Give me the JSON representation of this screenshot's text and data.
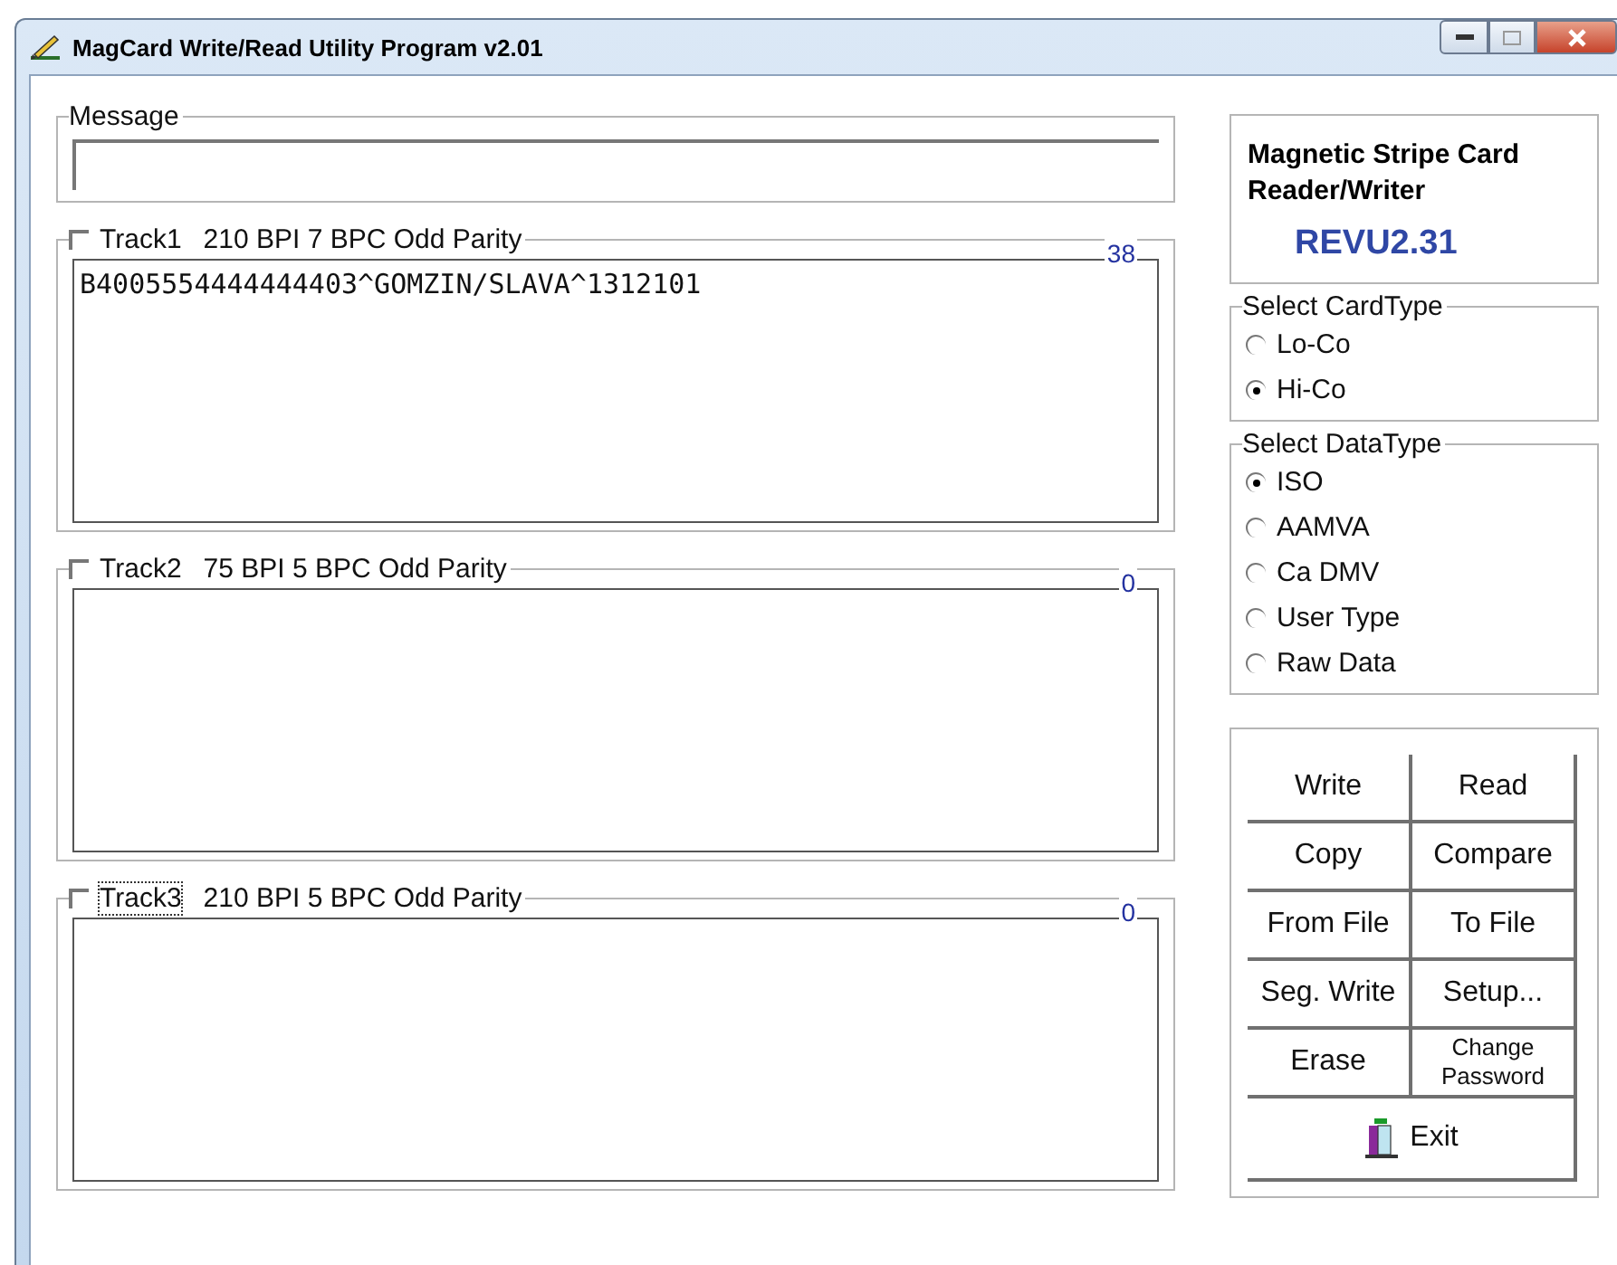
{
  "window": {
    "title": "MagCard Write/Read Utility Program v2.01"
  },
  "message": {
    "label": "Message"
  },
  "tracks": [
    {
      "label": "Track1",
      "spec": "210 BPI  7 BPC  Odd Parity",
      "count": "38",
      "checked": false,
      "focused": false,
      "value": "B4005554444444403^GOMZIN/SLAVA^1312101"
    },
    {
      "label": "Track2",
      "spec": "75 BPI  5 BPC  Odd Parity",
      "count": "0",
      "checked": false,
      "focused": false
    },
    {
      "label": "Track3",
      "spec": "210 BPI  5 BPC  Odd Parity",
      "count": "0",
      "checked": false,
      "focused": true
    }
  ],
  "device": {
    "title": "Magnetic Stripe Card Reader/Writer",
    "revision": "REVU2.31"
  },
  "card_type": {
    "label": "Select CardType",
    "options": [
      {
        "label": "Lo-Co",
        "selected": false
      },
      {
        "label": "Hi-Co",
        "selected": true
      }
    ]
  },
  "data_type": {
    "label": "Select DataType",
    "options": [
      {
        "label": "ISO",
        "selected": true
      },
      {
        "label": "AAMVA",
        "selected": false
      },
      {
        "label": "Ca DMV",
        "selected": false
      },
      {
        "label": "User Type",
        "selected": false
      },
      {
        "label": "Raw Data",
        "selected": false
      }
    ]
  },
  "buttons": [
    {
      "label": "Write"
    },
    {
      "label": "Read"
    },
    {
      "label": "Copy"
    },
    {
      "label": "Compare"
    },
    {
      "label": "From File"
    },
    {
      "label": "To File"
    },
    {
      "label": "Seg. Write"
    },
    {
      "label": "Setup..."
    },
    {
      "label": "Erase"
    },
    {
      "label": "Change Password",
      "small": true
    }
  ],
  "exit_button": {
    "label": "Exit"
  }
}
